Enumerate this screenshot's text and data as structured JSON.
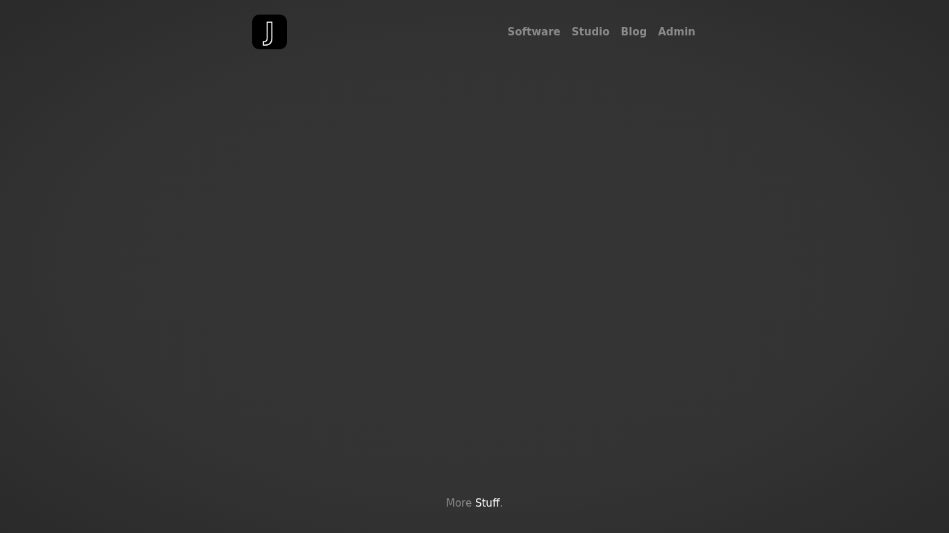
{
  "logo": {
    "letter": "J"
  },
  "nav": [
    {
      "label": "Software"
    },
    {
      "label": "Studio"
    },
    {
      "label": "Blog"
    },
    {
      "label": "Admin"
    }
  ],
  "footer": {
    "text": "More",
    "link": "Stuff",
    "after": "."
  }
}
